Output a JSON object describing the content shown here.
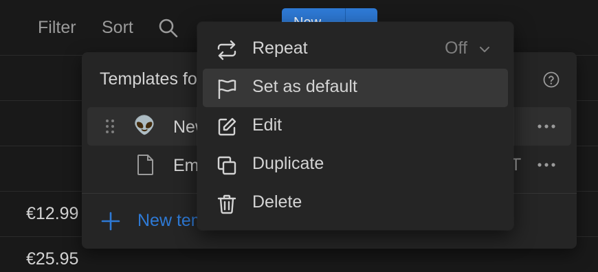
{
  "toolbar": {
    "filter_label": "Filter",
    "sort_label": "Sort",
    "search_icon": "search-icon",
    "new_label": "New"
  },
  "table": {
    "prices": [
      "€12.99",
      "€25.95"
    ]
  },
  "templates_panel": {
    "title": "Templates for",
    "help_icon": "help-circle-icon",
    "items": [
      {
        "icon": "alien-emoji",
        "emoji": "👽",
        "name": "New",
        "suffix": ""
      },
      {
        "icon": "document-icon",
        "emoji": "",
        "name": "Empty",
        "suffix": "T"
      }
    ],
    "new_template_label": "New template"
  },
  "context_menu": {
    "items": [
      {
        "icon": "repeat-icon",
        "label": "Repeat",
        "value": "Off"
      },
      {
        "icon": "flag-icon",
        "label": "Set as default"
      },
      {
        "icon": "edit-icon",
        "label": "Edit"
      },
      {
        "icon": "duplicate-icon",
        "label": "Duplicate"
      },
      {
        "icon": "trash-icon",
        "label": "Delete"
      }
    ]
  },
  "colors": {
    "background": "#191919",
    "panel": "#252525",
    "accent": "#2e7ad6",
    "text": "#d4d4d4",
    "muted": "#9b9b9b"
  }
}
